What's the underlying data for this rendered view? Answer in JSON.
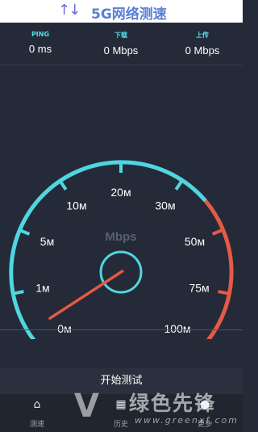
{
  "header": {
    "title": "5G网络测速",
    "icon": "up-down-arrows-icon"
  },
  "stats": [
    {
      "label": "PING",
      "value": "0 ms"
    },
    {
      "label": "下载",
      "value": "0 Mbps"
    },
    {
      "label": "上传",
      "value": "0 Mbps"
    }
  ],
  "gauge": {
    "unit": "Mbps",
    "ticks": [
      "0м",
      "1м",
      "5м",
      "10м",
      "20м",
      "30м",
      "50м",
      "75м",
      "100м"
    ],
    "needle_value": "0м",
    "colors": {
      "arc": "#4fd6e0",
      "high_arc": "#e35a45",
      "needle": "#e35a45",
      "label": "#ffffff",
      "unit": "#57606f"
    }
  },
  "actions": {
    "start": "开始测试"
  },
  "tabs": [
    {
      "label": "测速",
      "icon": "home-icon"
    },
    {
      "label": "历史",
      "icon": "grid-icon"
    },
    {
      "label": "更多",
      "icon": "person-icon"
    }
  ],
  "watermark": {
    "brand": "绿色先锋",
    "url": "www.greenxf.com"
  }
}
